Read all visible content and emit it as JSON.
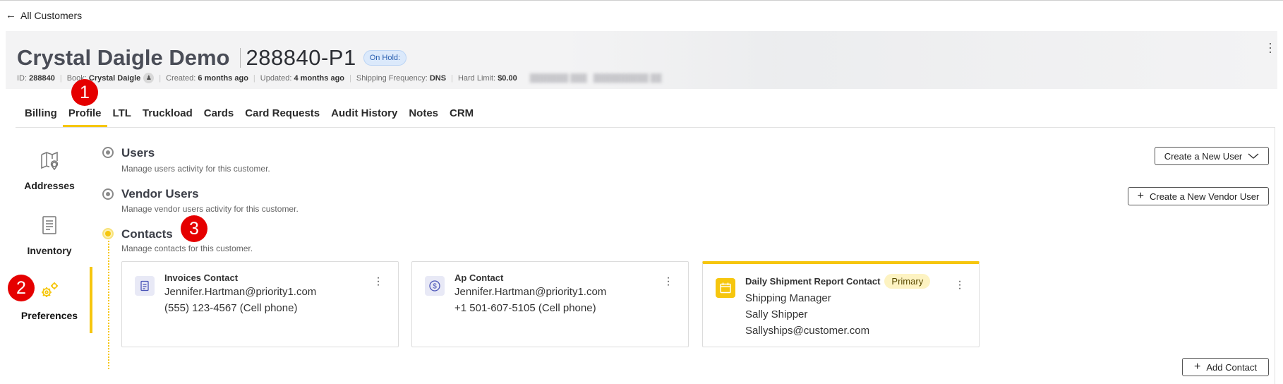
{
  "back_link": {
    "label": "All Customers"
  },
  "header": {
    "customer_name": "Crystal Daigle Demo",
    "account_number": "288840-P1",
    "status_badge": "On Hold:",
    "meta": {
      "id_label": "ID:",
      "id_value": "288840",
      "book_label": "Book:",
      "book_value": "Crystal Daigle",
      "created_label": "Created:",
      "created_value": "6 months ago",
      "updated_label": "Updated:",
      "updated_value": "4 months ago",
      "shipping_label": "Shipping Frequency:",
      "shipping_value": "DNS",
      "hard_limit_label": "Hard Limit:",
      "hard_limit_value": "$0.00"
    }
  },
  "tabs": [
    {
      "label": "Billing"
    },
    {
      "label": "Profile",
      "active": true
    },
    {
      "label": "LTL"
    },
    {
      "label": "Truckload"
    },
    {
      "label": "Cards"
    },
    {
      "label": "Card Requests"
    },
    {
      "label": "Audit History"
    },
    {
      "label": "Notes"
    },
    {
      "label": "CRM"
    }
  ],
  "side_nav": [
    {
      "label": "Addresses",
      "icon": "map-pin-icon"
    },
    {
      "label": "Inventory",
      "icon": "receipt-icon"
    },
    {
      "label": "Preferences",
      "icon": "gears-icon",
      "active": true
    }
  ],
  "sections": {
    "users": {
      "title": "Users",
      "subtitle": "Manage users activity for this customer.",
      "button": "Create a New User"
    },
    "vendor_users": {
      "title": "Vendor Users",
      "subtitle": "Manage vendor users activity for this customer.",
      "button": "Create a New Vendor User"
    },
    "contacts": {
      "title": "Contacts",
      "subtitle": "Manage contacts for this customer.",
      "button": "Add Contact"
    }
  },
  "contacts": [
    {
      "title": "Invoices Contact",
      "icon": "document-icon",
      "lines": [
        "Jennifer.Hartman@priority1.com",
        "(555) 123-4567 (Cell phone)"
      ]
    },
    {
      "title": "Ap Contact",
      "icon": "dollar-icon",
      "lines": [
        "Jennifer.Hartman@priority1.com",
        "+1 501-607-5105 (Cell phone)"
      ]
    },
    {
      "title": "Daily Shipment Report Contact",
      "icon": "calendar-icon",
      "badge": "Primary",
      "lines": [
        "Shipping Manager",
        "Sally Shipper",
        "Sallyships@customer.com"
      ]
    }
  ],
  "step_markers": [
    "1",
    "2",
    "3"
  ],
  "colors": {
    "accent": "#f6c60e",
    "marker": "#e50000",
    "badge_blue": "#dbe9fb"
  }
}
